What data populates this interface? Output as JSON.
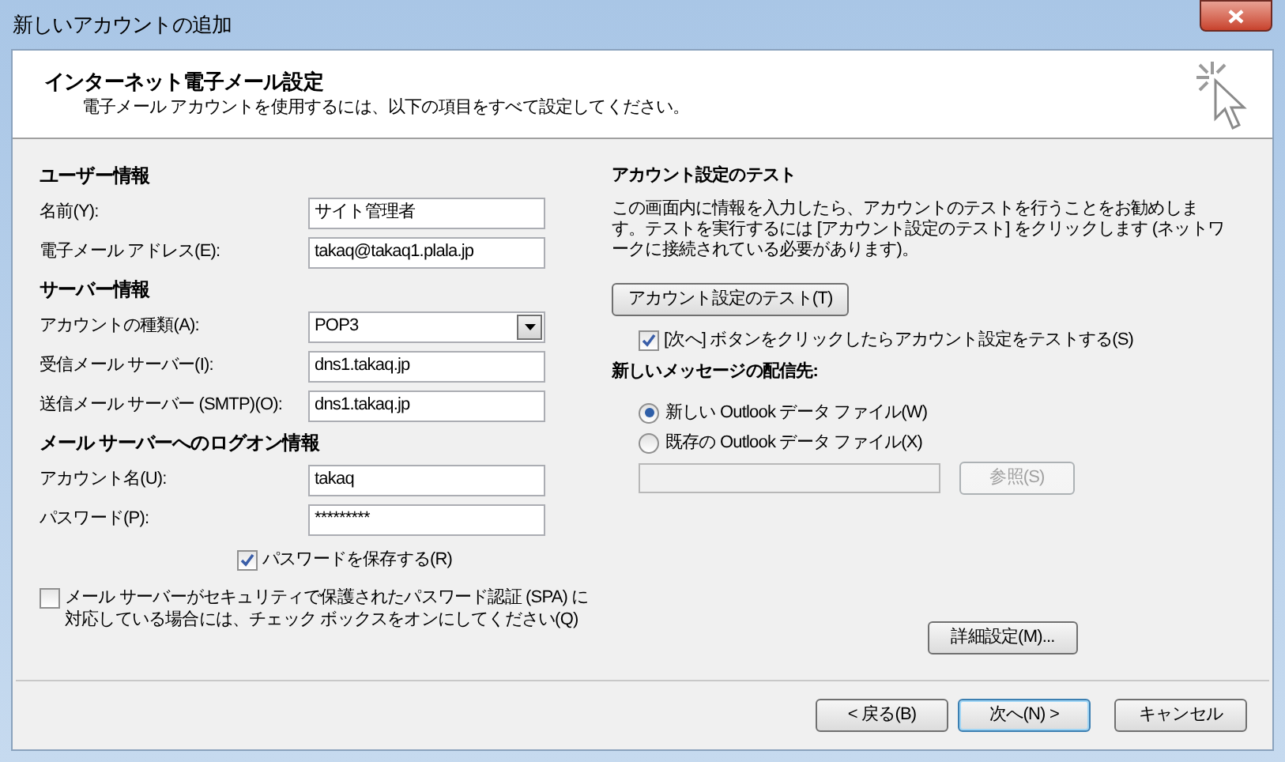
{
  "window": {
    "title": "新しいアカウントの追加"
  },
  "header": {
    "title": "インターネット電子メール設定",
    "subtitle": "電子メール アカウントを使用するには、以下の項目をすべて設定してください。"
  },
  "sections": [
    {
      "title": "ユーザー情報",
      "fields": [
        {
          "label": "名前(Y):",
          "value": "サイト管理者",
          "kind": "text"
        },
        {
          "label": "電子メール アドレス(E):",
          "value": "takaq@takaq1.plala.jp",
          "kind": "text"
        }
      ]
    },
    {
      "title": "サーバー情報",
      "fields": [
        {
          "label": "アカウントの種類(A):",
          "value": "POP3",
          "kind": "select"
        },
        {
          "label": "受信メール サーバー(I):",
          "value": "dns1.takaq.jp",
          "kind": "text"
        },
        {
          "label": "送信メール サーバー (SMTP)(O):",
          "value": "dns1.takaq.jp",
          "kind": "text"
        }
      ]
    },
    {
      "title": "メール サーバーへのログオン情報",
      "fields": [
        {
          "label": "アカウント名(U):",
          "value": "takaq",
          "kind": "text"
        },
        {
          "label": "パスワード(P):",
          "value": "*********",
          "kind": "text"
        }
      ]
    }
  ],
  "save_password": {
    "label": "パスワードを保存する(R)",
    "checked": true
  },
  "spa": {
    "label": "メール サーバーがセキュリティで保護されたパスワード認証 (SPA) に対応している場合には、チェック ボックスをオンにしてください(Q)",
    "checked": false
  },
  "test": {
    "title": "アカウント設定のテスト",
    "description": "この画面内に情報を入力したら、アカウントのテストを行うことをお勧めします。テストを実行するには [アカウント設定のテスト] をクリックします (ネットワークに接続されている必要があります)。",
    "button": "アカウント設定のテスト(T)"
  },
  "test_on_next": {
    "label": "[次へ] ボタンをクリックしたらアカウント設定をテストする(S)",
    "checked": true
  },
  "delivery": {
    "title": "新しいメッセージの配信先:",
    "options": [
      {
        "label": "新しい Outlook データ ファイル(W)",
        "selected": true
      },
      {
        "label": "既存の Outlook データ ファイル(X)",
        "selected": false
      }
    ],
    "browse_button": {
      "label": "参照(S)",
      "disabled": true
    }
  },
  "advanced_button": "詳細設定(M)...",
  "nav_buttons": [
    {
      "label": "< 戻る(B)",
      "default": false
    },
    {
      "label": "次へ(N) >",
      "default": true
    },
    {
      "label": "キャンセル",
      "default": false
    }
  ]
}
